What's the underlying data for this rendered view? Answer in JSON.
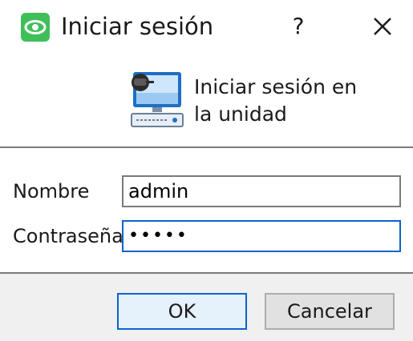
{
  "window": {
    "title": "Iniciar sesión",
    "help_label": "?",
    "app_icon": "eye-icon",
    "close_icon": "close-icon"
  },
  "header": {
    "icon": "computer-login-icon",
    "line1": "Iniciar sesión en",
    "line2": "la unidad"
  },
  "form": {
    "username_label": "Nombre",
    "username_value": "admin",
    "password_label": "Contraseña",
    "password_value": "•••••"
  },
  "buttons": {
    "ok_label": "OK",
    "cancel_label": "Cancelar"
  },
  "colors": {
    "accent": "#0a64c8",
    "app_icon_green": "#3fbf5a"
  }
}
